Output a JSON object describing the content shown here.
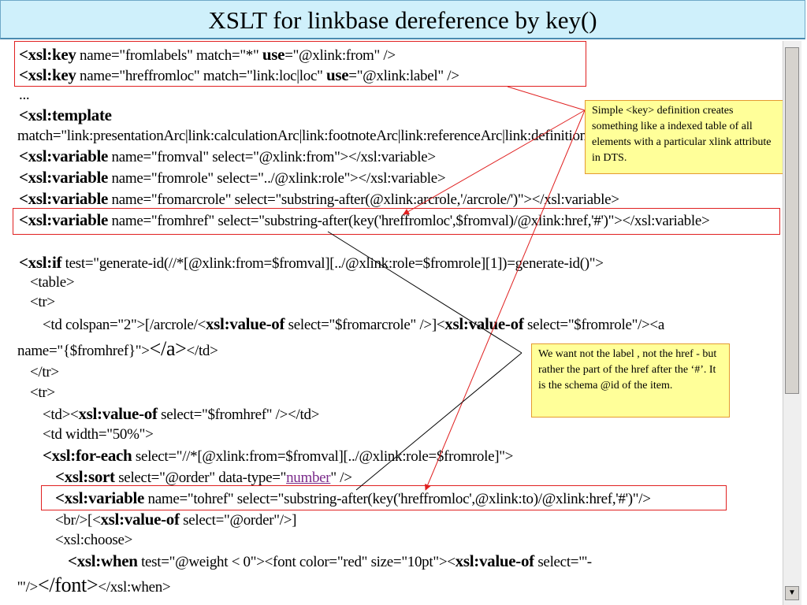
{
  "title": "XSLT for linkbase dereference by key()",
  "code": {
    "l1": {
      "tag": "<xsl:key",
      "a": " name=\"fromlabels\" match=\"*\" ",
      "use": "use",
      "b": "=\"@xlink:from\" />"
    },
    "l2": {
      "tag": "<xsl:key",
      "a": " name=\"hreffromloc\" match=\"link:loc|loc\" ",
      "use": "use",
      "b": "=\"@xlink:label\" />"
    },
    "l3": "...",
    "l4": "<xsl:template",
    "l5": "match=\"link:presentationArc|link:calculationArc|link:footnoteArc|link:referenceArc|link:definitionArc\">",
    "l6": {
      "tag": "<xsl:variable",
      "rest": " name=\"fromval\" select=\"@xlink:from\"></xsl:variable>"
    },
    "l7": {
      "tag": "<xsl:variable",
      "rest": " name=\"fromrole\" select=\"../@xlink:role\"></xsl:variable>"
    },
    "l8": {
      "tag": "<xsl:variable",
      "rest": " name=\"fromarcrole\" select=\"substring-after(@xlink:arcrole,'/arcrole/')\"></xsl:variable>"
    },
    "l9": {
      "tag": "<xsl:variable",
      "rest": " name=\"fromhref\" select=\"substring-after(key('hreffromloc',$fromval)/@xlink:href,'#')\"></xsl:variable>"
    },
    "l10": {
      "tag": "<xsl:if",
      "rest": " test=\"generate-id(//*[@xlink:from=$fromval][../@xlink:role=$fromrole][1])=generate-id()\">"
    },
    "l11": "<table>",
    "l12": "<tr>",
    "l13": {
      "a": "<td colspan=\"2\">[/arcrole/<",
      "t1": "xsl:value-of",
      "b": " select=\"$fromarcrole\" />]<",
      "t2": "xsl:value-of",
      "c": " select=\"$fromrole\"/><a"
    },
    "l14": {
      "a": "name=\"{$fromhref}\">",
      "big": "</a>",
      "b": "</td>"
    },
    "l15": "</tr>",
    "l16": "<tr>",
    "l17": {
      "a": "<td><",
      "t": "xsl:value-of",
      "b": " select=\"$fromhref\" /></td>"
    },
    "l18": "<td width=\"50%\">",
    "l19": {
      "tag": "<xsl:for-each",
      "rest": " select=\"//*[@xlink:from=$fromval][../@xlink:role=$fromrole]\">"
    },
    "l20": {
      "tag": "<xsl:sort",
      "a": " select=\"@order\" data-type=\"",
      "link": "number",
      "b": "\" />"
    },
    "l21": {
      "tag": "<xsl:variable",
      "rest": " name=\"tohref\" select=\"substring-after(key('hreffromloc',@xlink:to)/@xlink:href,'#')\"/>"
    },
    "l22": {
      "a": "<br/>[<",
      "t": "xsl:value-of",
      "b": " select=\"@order\"/>]"
    },
    "l23": "<xsl:choose>",
    "l24": {
      "tag": "<xsl:when",
      "a": " test=\"@weight < 0\"><font color=\"red\" size=\"10pt\"><",
      "t": "xsl:value-of",
      "b": " select=\"'-"
    },
    "l25": {
      "a": "'\"/>",
      "big": "</font>",
      "b": "</xsl:when>"
    }
  },
  "callouts": {
    "key_note": "Simple <key> definition creates something like a indexed table of all elements with a particular xlink attribute in DTS.",
    "href_note": "We want not the label , not the href - but rather the part of the href after the ‘#’. It is the schema @id of the item."
  },
  "colors": {
    "title_bg": "#cff0fb",
    "highlight": "#e02020",
    "callout_bg": "#ffff99",
    "callout_border": "#e49a2f"
  }
}
